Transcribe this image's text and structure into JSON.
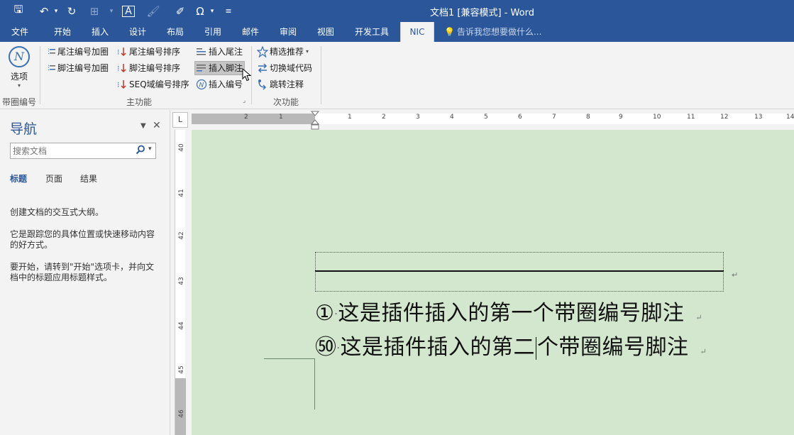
{
  "window": {
    "title": "文档1 [兼容模式] - Word"
  },
  "qat": {
    "save": "🖫",
    "undo": "↶",
    "undo_dd": "▾",
    "redo": "↻",
    "table": "⊞",
    "table_dd": "▾",
    "textbox": "A",
    "brush": "🖌",
    "omega": "Ω",
    "omega_dd": "▾",
    "customize": "≡"
  },
  "tabs": [
    "文件",
    "开始",
    "插入",
    "设计",
    "布局",
    "引用",
    "邮件",
    "审阅",
    "视图",
    "开发工具",
    "NIC"
  ],
  "active_tab": "NIC",
  "tellme": "告诉我您想要做什么...",
  "ribbon": {
    "big_button": {
      "icon": "N",
      "label": "选项",
      "dd": "▾"
    },
    "group1_label": "带圈编号",
    "main": {
      "btn1": "尾注编号加圈",
      "btn2": "脚注编号加圈",
      "btn3": "尾注编号排序",
      "btn4": "脚注编号排序",
      "btn5": "SEQ域编号排序",
      "btn6": "插入尾注",
      "btn7": "插入脚注",
      "btn8": "插入编号",
      "label": "主功能",
      "launcher": "⌟"
    },
    "secondary": {
      "btn1": "精选推荐",
      "btn1_dd": "▾",
      "btn2": "切换域代码",
      "btn3": "跳转注释",
      "label": "次功能"
    }
  },
  "nav": {
    "title": "导航",
    "dropdown": "▼",
    "close": "✕",
    "search_placeholder": "搜索文档",
    "search_dd": "▾",
    "tabs": [
      "标题",
      "页面",
      "结果"
    ],
    "p1": "创建文档的交互式大纲。",
    "p2": "它是跟踪您的具体位置或快速移动内容的好方式。",
    "p3": "要开始，请转到\"开始\"选项卡，并向文档中的标题应用标题样式。"
  },
  "ruler": {
    "corner": "L",
    "h_numbers": [
      "2",
      "1",
      "1",
      "2",
      "3",
      "4",
      "5",
      "6",
      "7",
      "8",
      "9",
      "10",
      "11",
      "12",
      "13",
      "14"
    ],
    "v_numbers": [
      "40",
      "41",
      "42",
      "43",
      "44",
      "45",
      "46"
    ]
  },
  "document": {
    "para_mark": "↵",
    "footnote1": {
      "num": "①",
      "dot": "·",
      "text_before": "这是插件插入的第一个带圈编号脚注",
      "text_after": ""
    },
    "footnote2": {
      "num": "㊿",
      "dot": "·",
      "text_before": "这是插件插入的第二",
      "text_after": "个带圈编号脚注"
    }
  }
}
